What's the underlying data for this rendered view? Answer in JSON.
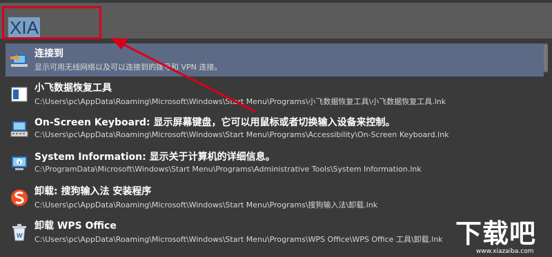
{
  "search": {
    "query": "XIA"
  },
  "results": [
    {
      "title": "连接到",
      "subtitle": "显示可用无线网络以及可以连接到的拨号和 VPN 连接。",
      "icon": "network-connect-icon",
      "selected": true
    },
    {
      "title": "小飞数据恢复工具",
      "subtitle": "C:\\Users\\pc\\AppData\\Roaming\\Microsoft\\Windows\\Start Menu\\Programs\\小飞数据恢复工具\\小飞数据恢复工具.lnk",
      "icon": "app-window-icon"
    },
    {
      "title": "On-Screen Keyboard: 显示屏幕键盘，它可以用鼠标或者切换输入设备来控制。",
      "subtitle": "C:\\Users\\pc\\AppData\\Roaming\\Microsoft\\Windows\\Start Menu\\Programs\\Accessibility\\On-Screen Keyboard.lnk",
      "icon": "keyboard-icon"
    },
    {
      "title": "System Information: 显示关于计算机的详细信息。",
      "subtitle": "C:\\ProgramData\\Microsoft\\Windows\\Start Menu\\Programs\\Administrative Tools\\System Information.lnk",
      "icon": "system-info-icon"
    },
    {
      "title": "卸载: 搜狗输入法 安装程序",
      "subtitle": "C:\\Users\\pc\\AppData\\Roaming\\Microsoft\\Windows\\Start Menu\\Programs\\搜狗输入法\\卸载.lnk",
      "icon": "sogou-icon"
    },
    {
      "title": "卸载 WPS Office",
      "subtitle": "C:\\Users\\pc\\AppData\\Roaming\\Microsoft\\Windows\\Start Menu\\Programs\\WPS Office\\WPS Office 工具\\卸载.lnk",
      "icon": "wps-uninstall-icon"
    }
  ],
  "watermark": {
    "big": "下载吧",
    "small": "www.xiazaiba.com"
  },
  "colors": {
    "selection": "#5d6a85",
    "callout": "#d7001c",
    "background": "#3a3a3a"
  }
}
